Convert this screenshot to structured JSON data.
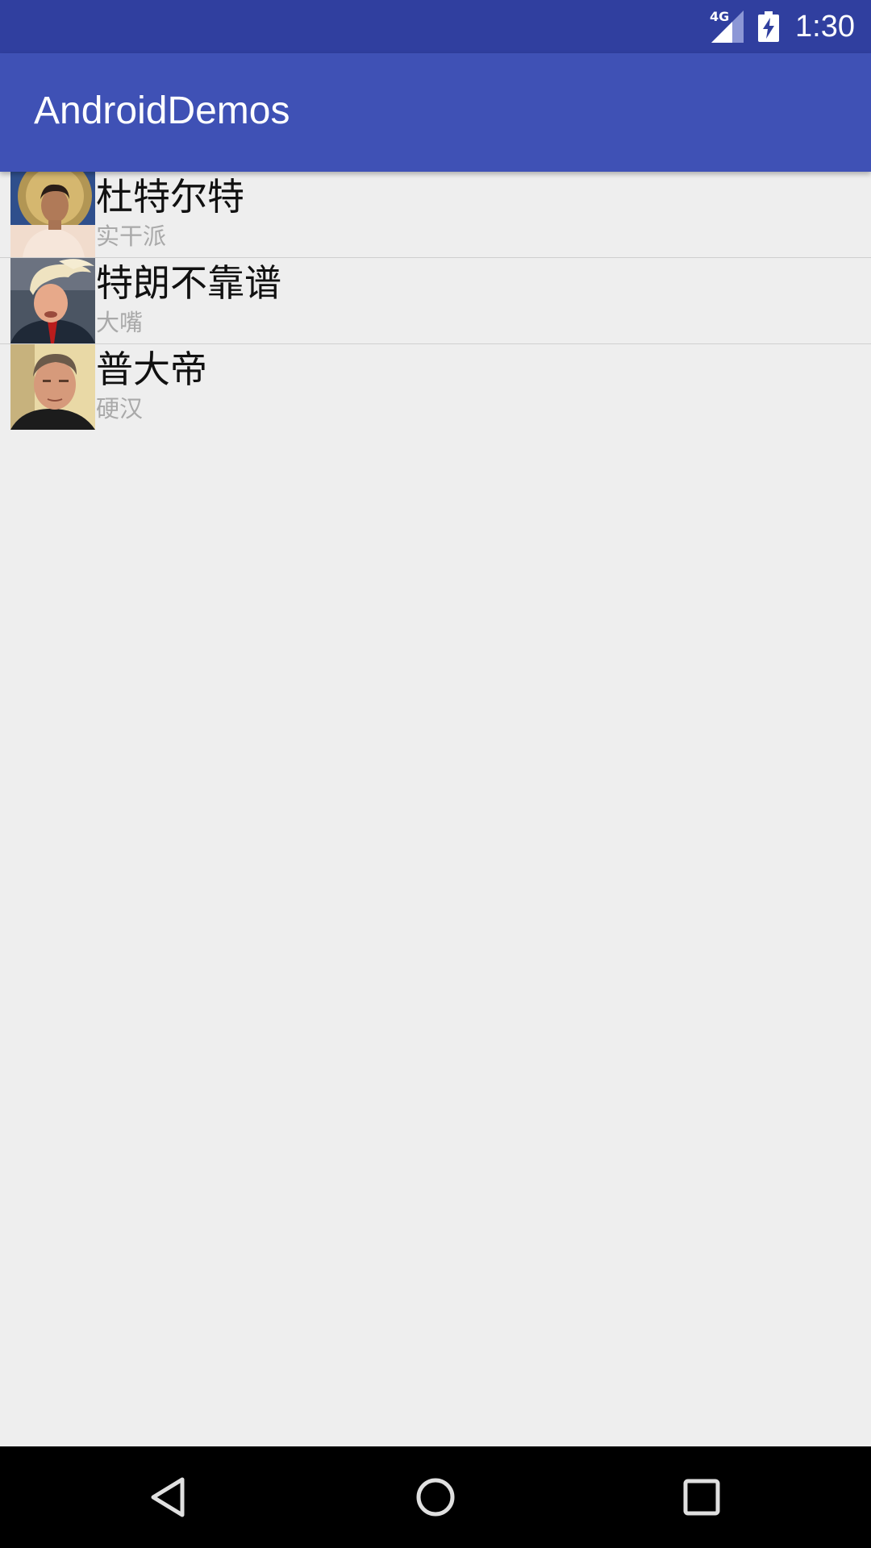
{
  "status_bar": {
    "network": "4G",
    "time": "1:30"
  },
  "app_bar": {
    "title": "AndroidDemos"
  },
  "list": {
    "items": [
      {
        "name": "杜特尔特",
        "subtitle": "实干派"
      },
      {
        "name": "特朗不靠谱",
        "subtitle": "大嘴"
      },
      {
        "name": "普大帝",
        "subtitle": "硬汉"
      }
    ]
  },
  "colors": {
    "status_bar": "#303f9f",
    "app_bar": "#3f51b5",
    "background": "#eeeeee",
    "subtitle": "#a9a9a9"
  },
  "icons": {
    "signal": "signal-icon",
    "battery": "battery-charging-icon",
    "back": "back-icon",
    "home": "home-icon",
    "recents": "recents-icon"
  }
}
